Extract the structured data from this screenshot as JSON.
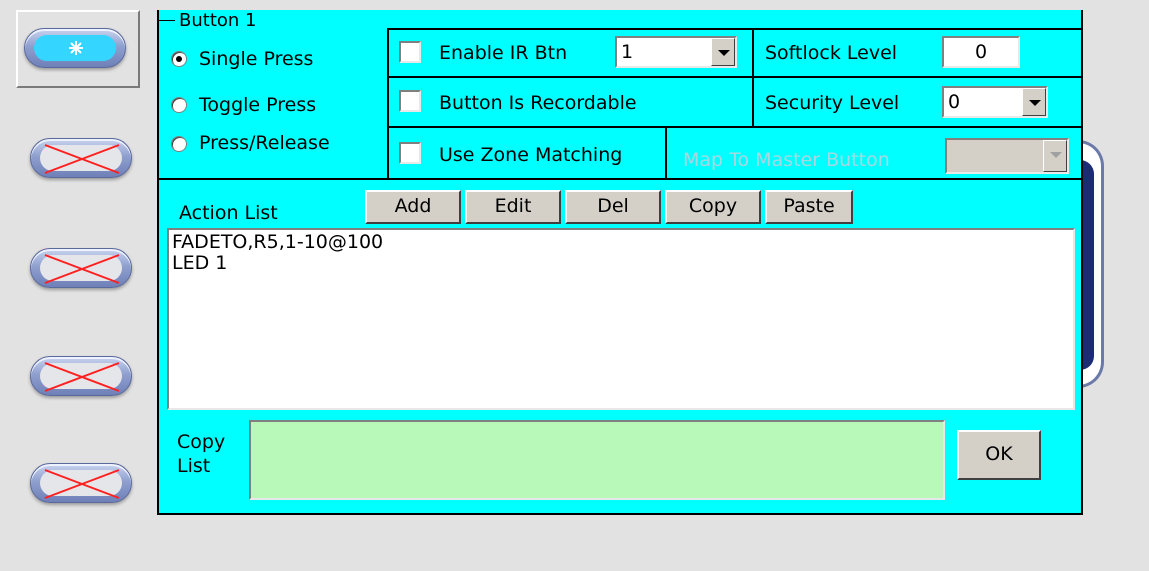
{
  "keypad": {
    "buttons": [
      {
        "state": "active",
        "icon": "sparkle-icon"
      },
      {
        "state": "unassigned",
        "icon": "cross-icon"
      },
      {
        "state": "unassigned",
        "icon": "cross-icon"
      },
      {
        "state": "unassigned",
        "icon": "cross-icon"
      },
      {
        "state": "unassigned",
        "icon": "cross-icon"
      }
    ]
  },
  "group": {
    "title": "Button 1"
  },
  "press_mode": {
    "options": [
      "Single Press",
      "Toggle Press",
      "Press/Release"
    ],
    "selected": "Single Press"
  },
  "enable_ir": {
    "label": "Enable IR Btn",
    "checked": false,
    "value": "1"
  },
  "recordable": {
    "label": "Button Is Recordable",
    "checked": false
  },
  "zone_matching": {
    "label": "Use Zone Matching",
    "checked": false
  },
  "softlock": {
    "label": "Softlock Level",
    "value": "0"
  },
  "security": {
    "label": "Security Level",
    "value": "0"
  },
  "map_master": {
    "label": "Map To Master Button",
    "value": "",
    "enabled": false
  },
  "actions": {
    "label": "Action List",
    "buttons": {
      "add": "Add",
      "edit": "Edit",
      "del": "Del",
      "copy": "Copy",
      "paste": "Paste"
    },
    "items": [
      "FADETO,R5,1-10@100",
      "LED 1"
    ]
  },
  "copy_list": {
    "label_line1": "Copy",
    "label_line2": "List",
    "value": ""
  },
  "ok_label": "OK",
  "colors": {
    "panel": "#00ffff",
    "copy_box": "#b8f8b8",
    "active_button": "#34d6ff",
    "cross": "#ff2020"
  }
}
